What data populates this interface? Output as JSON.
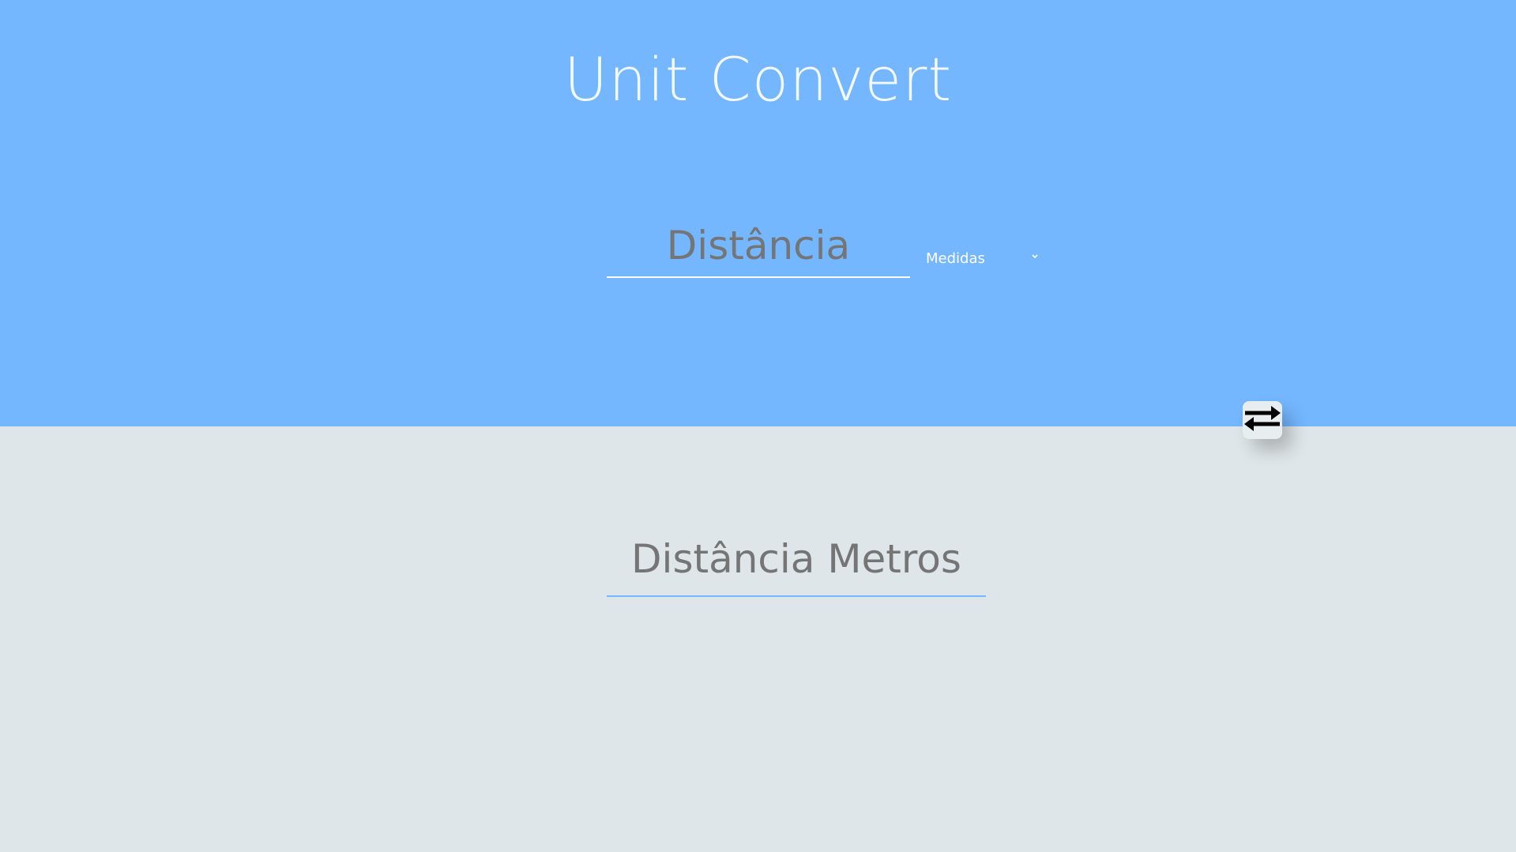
{
  "header": {
    "title": "Unit Convert"
  },
  "converter": {
    "input_placeholder": "Distância",
    "input_value": "",
    "unit_select": {
      "selected": "Medidas",
      "icon": "chevron-down-icon"
    },
    "swap_button": {
      "icon": "swap-arrows-icon"
    },
    "output_placeholder": "Distância Metros",
    "output_value": ""
  },
  "colors": {
    "top_background": "#74b7ff",
    "bottom_background": "#dfe6e9",
    "text_gray": "#757575",
    "output_underline": "#74b7ff"
  }
}
